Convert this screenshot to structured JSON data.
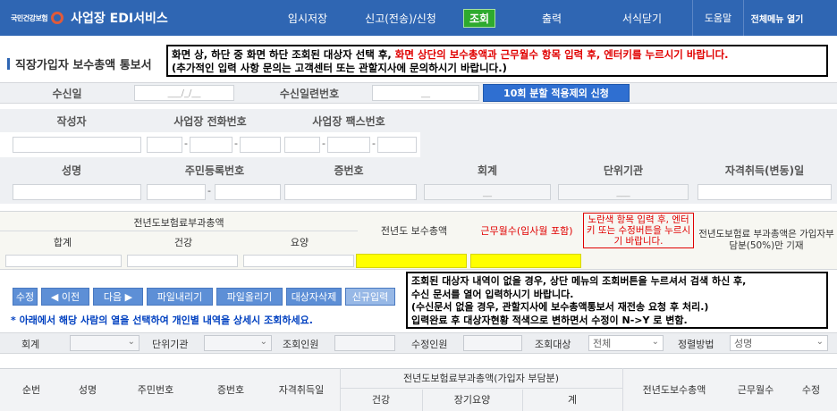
{
  "header": {
    "logo_text": "국민건강보험",
    "app_title": "사업장 EDI서비스",
    "nav": [
      {
        "label": "임시저장"
      },
      {
        "label": "신고(전송)/신청"
      },
      {
        "label": "조회"
      },
      {
        "label": "출력"
      },
      {
        "label": "서식닫기"
      },
      {
        "label": "도움말"
      },
      {
        "label": "전체메뉴 열기"
      }
    ],
    "colors": {
      "bar": "#2f66b3",
      "active": "#2eaa2e"
    }
  },
  "page_title": "직장가입자 보수총액 통보서",
  "notice_top": {
    "line1_a": "화면 상, 하단 중 화면 하단 조회된 대상자 선택 후, ",
    "line1_b": "화면 상단의 보수총액과 근무월수 항목 입력 후, 엔터키를 누르시기 바랍니다.",
    "line2": "(추가적인 입력 사항 문의는 고객센터 또는 관할지사에 문의하시기 바랍니다.)"
  },
  "receipt": {
    "date_label": "수신일",
    "date_value": "___/_/__",
    "serial_label": "수신일련번호",
    "serial_value": "__",
    "exclude_button": "10회 분할 적용제외 신청"
  },
  "author_section": {
    "author_label": "작성자",
    "phone_label": "사업장 전화번호",
    "fax_label": "사업장 팩스번호"
  },
  "person_section": {
    "name_label": "성명",
    "rrn_label": "주민등록번호",
    "card_label": "증번호",
    "account_label": "회계",
    "unit_label": "단위기관",
    "acquire_label": "자격취득(변동)일",
    "account_value": "__",
    "unit_value": "___"
  },
  "premium_section": {
    "group_label": "전년도보험료부과총액",
    "total_label": "합계",
    "health_label": "건강",
    "care_label": "요양",
    "annual_pay_label": "전년도 보수총액",
    "months_label": "근무월수(입사월 포함)",
    "yellow_note": "노란색 항목 입력 후, 엔터키 또는 수정버튼을 누르시기 바랍니다.",
    "half_note": "전년도보험료 부과총액은 가입자부담분(50%)만 기재"
  },
  "toolbar": {
    "buttons": [
      "수정",
      "◀ 이전",
      "다음 ▶",
      "파일내리기",
      "파일올리기",
      "대상자삭제",
      "신규입력"
    ]
  },
  "notice_bottom": {
    "l1": "조회된 대상자 내역이 없을 경우, 상단 메뉴의 조회버튼을 누르셔서 검색 하신 후,",
    "l2": "수신 문서를 열어 입력하시기 바랍니다.",
    "l3": "(수신문서 없을 경우, 관할지사에 보수총액통보서 재전송 요청 후 처리.)",
    "l4": "입력완료 후 대상자현황 적색으로 변하면서 수정이 N->Y 로 변함."
  },
  "tip": "* 아래에서 해당 사람의 열을 선택하여 개인별 내역을 상세시 조회하세요.",
  "search": {
    "account_label": "회계",
    "unit_label": "단위기관",
    "inquired_label": "조회인원",
    "modified_label": "수정인원",
    "target_label": "조회대상",
    "target_value": "전체",
    "sort_label": "정렬방법",
    "sort_value": "성명"
  },
  "list_header": {
    "no": "순번",
    "name": "성명",
    "rrn": "주민번호",
    "card": "증번호",
    "acquire": "자격취득일",
    "group": "전년도보험료부과총액(가입자 부담분)",
    "health": "건강",
    "care": "장기요양",
    "sum": "계",
    "annual_pay": "전년도보수총액",
    "months": "근무월수",
    "edit": "수정"
  }
}
